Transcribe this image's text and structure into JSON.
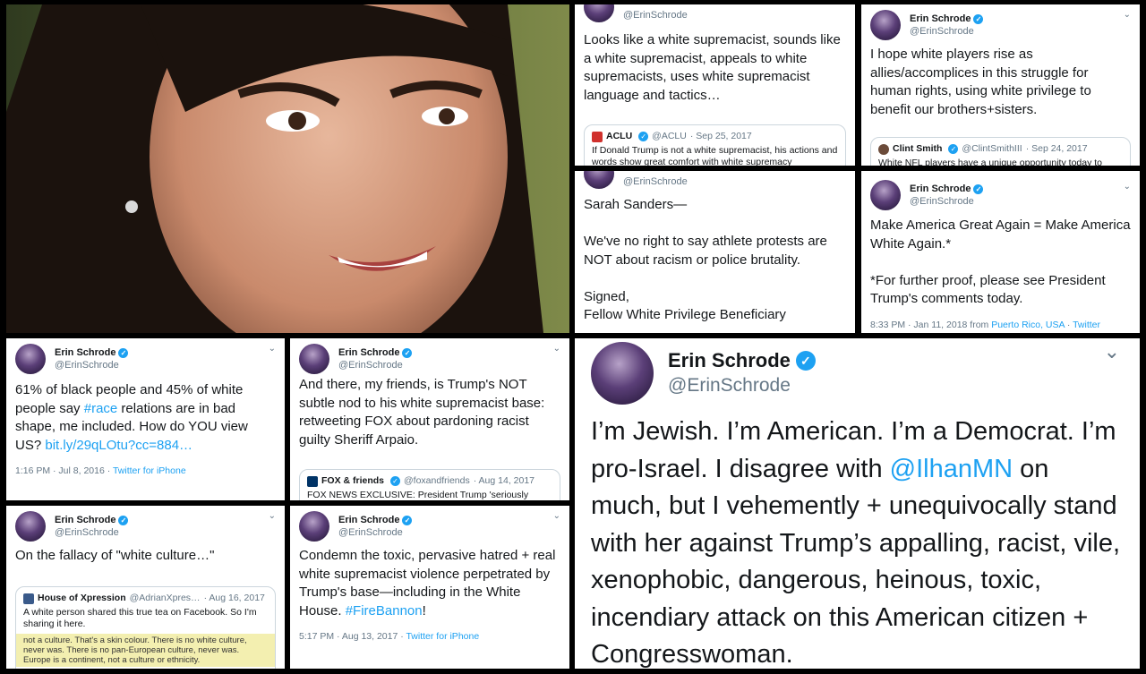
{
  "tweets": {
    "t1": {
      "handle": "@ErinSchrode",
      "text": "Looks like a white supremacist, sounds like a white supremacist, appeals to white supremacists, uses white supremacist language and tactics…",
      "quote": {
        "name": "ACLU",
        "handle": "@ACLU",
        "date": "· Sep 25, 2017",
        "text": "If Donald Trump is not a white supremacist, his actions and words show great comfort with white supremacy"
      }
    },
    "t2": {
      "name": "Erin Schrode",
      "handle": "@ErinSchrode",
      "text": "I hope white players rise as allies/accomplices in this struggle for human rights, using white privilege to benefit our brothers+sisters.",
      "quote": {
        "name": "Clint Smith",
        "handle": "@ClintSmithIII",
        "date": "· Sep 24, 2017",
        "text": "White NFL players have a unique opportunity today to"
      }
    },
    "t3": {
      "handle": "@ErinSchrode",
      "text": "Sarah Sanders—\n\nWe've no right to say athlete protests are NOT about racism or police brutality.\n\nSigned,\nFellow White Privilege Beneficiary"
    },
    "t4": {
      "name": "Erin Schrode",
      "handle": "@ErinSchrode",
      "text": "Make America Great Again = Make America White Again.*\n\n*For further proof, please see President Trump's comments today.",
      "meta_time": "8:33 PM · Jan 11, 2018 from ",
      "meta_place": "Puerto Rico, USA",
      "meta_sep": " · ",
      "meta_source": "Twitter"
    },
    "t5": {
      "name": "Erin Schrode",
      "handle": "@ErinSchrode",
      "text_a": "61% of black people and 45% of white people say ",
      "hashtag": "#race",
      "text_b": " relations are in bad shape, me included. How do YOU view US? ",
      "link": "bit.ly/29qLOtu?cc=884…",
      "meta_time": "1:16 PM · Jul 8, 2016 · ",
      "meta_source": "Twitter for iPhone"
    },
    "t6": {
      "name": "Erin Schrode",
      "handle": "@ErinSchrode",
      "text": "And there, my friends, is Trump's NOT subtle nod to his white supremacist base: retweeting FOX about pardoning racist guilty Sheriff Arpaio.",
      "quote": {
        "name": "FOX & friends",
        "handle": "@foxandfriends",
        "date": "· Aug 14, 2017",
        "text": "FOX NEWS EXCLUSIVE: President Trump 'seriously"
      }
    },
    "t7": {
      "name": "Erin Schrode",
      "handle": "@ErinSchrode",
      "text": "On the fallacy of \"white culture…\"",
      "quote": {
        "name": "House of Xpression",
        "handle": "@AdrianXpres…",
        "date": "· Aug 16, 2017",
        "text": "A white person shared this true tea on Facebook. So I'm sharing it here.",
        "image_text": "not a culture. That's a skin colour. There is no white culture, never was. There is no pan-European culture, never was. Europe is a continent, not a culture or ethnicity."
      }
    },
    "t8": {
      "name": "Erin Schrode",
      "handle": "@ErinSchrode",
      "text_a": "Condemn the toxic, pervasive hatred + real white supremacist violence perpetrated by Trump's base—including in the White House. ",
      "hashtag": "#FireBannon",
      "text_b": "!",
      "meta_time": "5:17 PM · Aug 13, 2017 · ",
      "meta_source": "Twitter for iPhone"
    },
    "t9": {
      "name": "Erin Schrode",
      "handle": "@ErinSchrode",
      "text_a": "I’m Jewish. I’m American. I’m a Democrat. I’m pro-Israel. I disagree with ",
      "mention": "@IlhanMN",
      "text_b": " on much, but I vehemently + unequivocally stand with her against Trump’s appalling, racist, vile, xenophobic, dangerous, heinous, toxic, incendiary attack on this American citizen + Congresswoman."
    }
  },
  "colors": {
    "link": "#1da1f2",
    "verified": "#1da1f2",
    "muted": "#657786"
  },
  "icons": {
    "verified": "verified-badge-icon",
    "chevron": "chevron-down-icon"
  }
}
